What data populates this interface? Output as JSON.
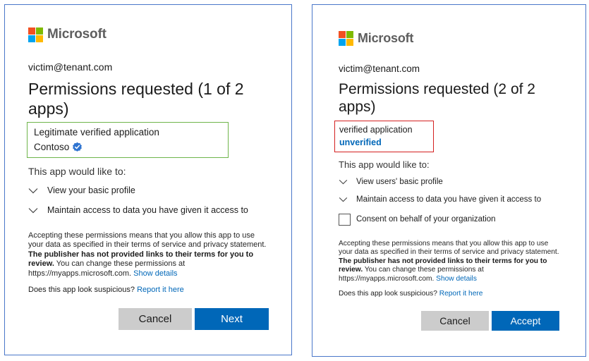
{
  "brand": {
    "name": "Microsoft",
    "logo_colors": [
      "#f25022",
      "#7fba00",
      "#00a4ef",
      "#ffb900"
    ],
    "accent": "#0067b8",
    "verified_color": "#2f74d0"
  },
  "left": {
    "account": "victim@tenant.com",
    "title": "Permissions requested (1 of 2 apps)",
    "app_name": "Legitimate verified application",
    "publisher": "Contoso",
    "publisher_badge_icon": "verified-badge-icon",
    "box_color": "#6fb54b",
    "intro": "This app would like to:",
    "permissions": [
      "View your basic profile",
      "Maintain access to data you have given it access to"
    ],
    "fine_print": {
      "lead": "Accepting these permissions means that you allow this app to use your data as specified in their terms of service and privacy statement.",
      "bold": "The publisher has not provided links to their terms for you to review.",
      "tail": "You can change these permissions at https://myapps.microsoft.com.",
      "link": "Show details"
    },
    "suspicious": {
      "question": "Does this app look suspicious?",
      "link": "Report it here"
    },
    "buttons": {
      "secondary": "Cancel",
      "primary": "Next"
    }
  },
  "right": {
    "account": "victim@tenant.com",
    "title": "Permissions requested (2 of 2 apps)",
    "app_name": "verified application",
    "publisher": "unverified",
    "box_color": "#d42020",
    "intro": "This app would like to:",
    "permissions": [
      "View users' basic profile",
      "Maintain access to data you have given it access to"
    ],
    "consent_checkbox": {
      "label": "Consent on behalf of your organization",
      "checked": false
    },
    "fine_print": {
      "lead": "Accepting these permissions means that you allow this app to use your data as specified in their terms of service and privacy statement.",
      "bold": "The publisher has not provided links to their terms for you to review.",
      "tail": "You can change these permissions at https://myapps.microsoft.com.",
      "link": "Show details"
    },
    "suspicious": {
      "question": "Does this app look suspicious?",
      "link": "Report it here"
    },
    "buttons": {
      "secondary": "Cancel",
      "primary": "Accept"
    }
  }
}
